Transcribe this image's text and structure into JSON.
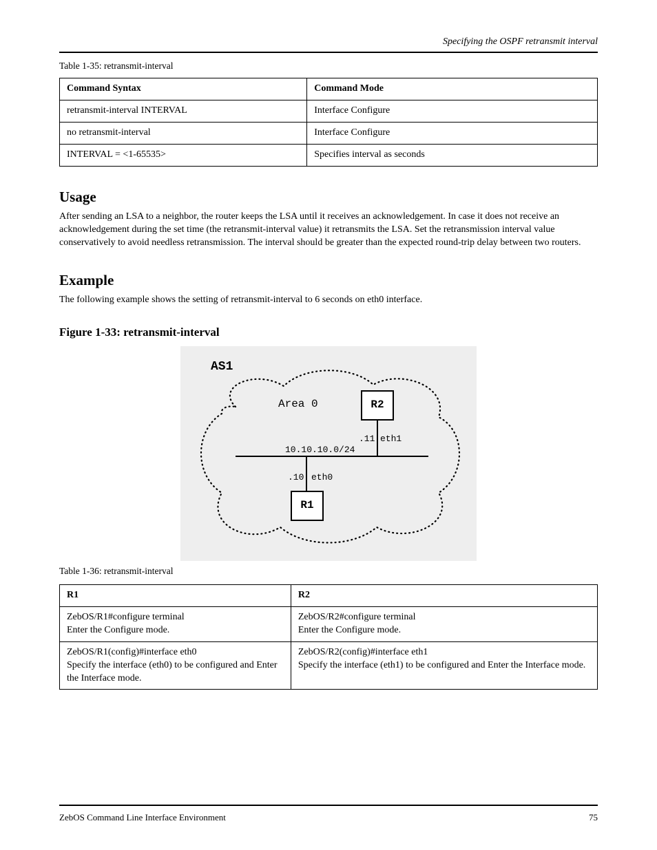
{
  "header_right": "Specifying the OSPF retransmit interval",
  "table1": {
    "caption": "Table 1-35: retransmit-interval",
    "h1": "Command Syntax",
    "h2": "Command Mode",
    "r1c1": "retransmit-interval INTERVAL",
    "r1c2": "Interface Configure",
    "r2c1": "no retransmit-interval",
    "r2c2": "Interface Configure",
    "r3c1": "INTERVAL = <1-65535>",
    "r3c2": "Specifies interval as seconds"
  },
  "s1_h": "Usage",
  "s1_p": "After sending an LSA to a neighbor, the router keeps the LSA until it receives an acknowledgement. In case it does not receive an acknowledgement during the set time (the retransmit-interval value) it retransmits the LSA. Set the retransmission interval value conservatively to avoid needless retransmission. The interval should be greater than the expected round-trip delay between two routers.",
  "s2_h": "Example",
  "s2_p": "The following example shows the setting of retransmit-interval to 6 seconds on eth0 interface.",
  "fig_h": "Figure 1-33: retransmit-interval",
  "fig": {
    "as": "AS1",
    "area": "Area 0",
    "r1": "R1",
    "r2": "R2",
    "subnet": "10.10.10.0/24",
    "ip_r1": ".10",
    "eth_r1": "eth0",
    "ip_r2": ".11",
    "eth_r2": "eth1"
  },
  "table2": {
    "caption": "Table 1-36: retransmit-interval",
    "h1": "R1",
    "h2": "R2",
    "r1c1_l1": "ZebOS/R1#configure terminal",
    "r1c1_l2": "Enter the Configure mode.",
    "r1c2_l1": "ZebOS/R2#configure terminal",
    "r1c2_l2": "Enter the Configure mode.",
    "r2c1_l1": "ZebOS/R1(config)#interface eth0",
    "r2c1_l2": "Specify the interface (eth0) to be configured and Enter the Interface mode.",
    "r2c2_l1": "ZebOS/R2(config)#interface eth1",
    "r2c2_l2": "Specify the interface (eth1) to be configured and Enter the Interface mode."
  },
  "footer": {
    "left": "ZebOS Command Line Interface Environment",
    "right": "75"
  }
}
